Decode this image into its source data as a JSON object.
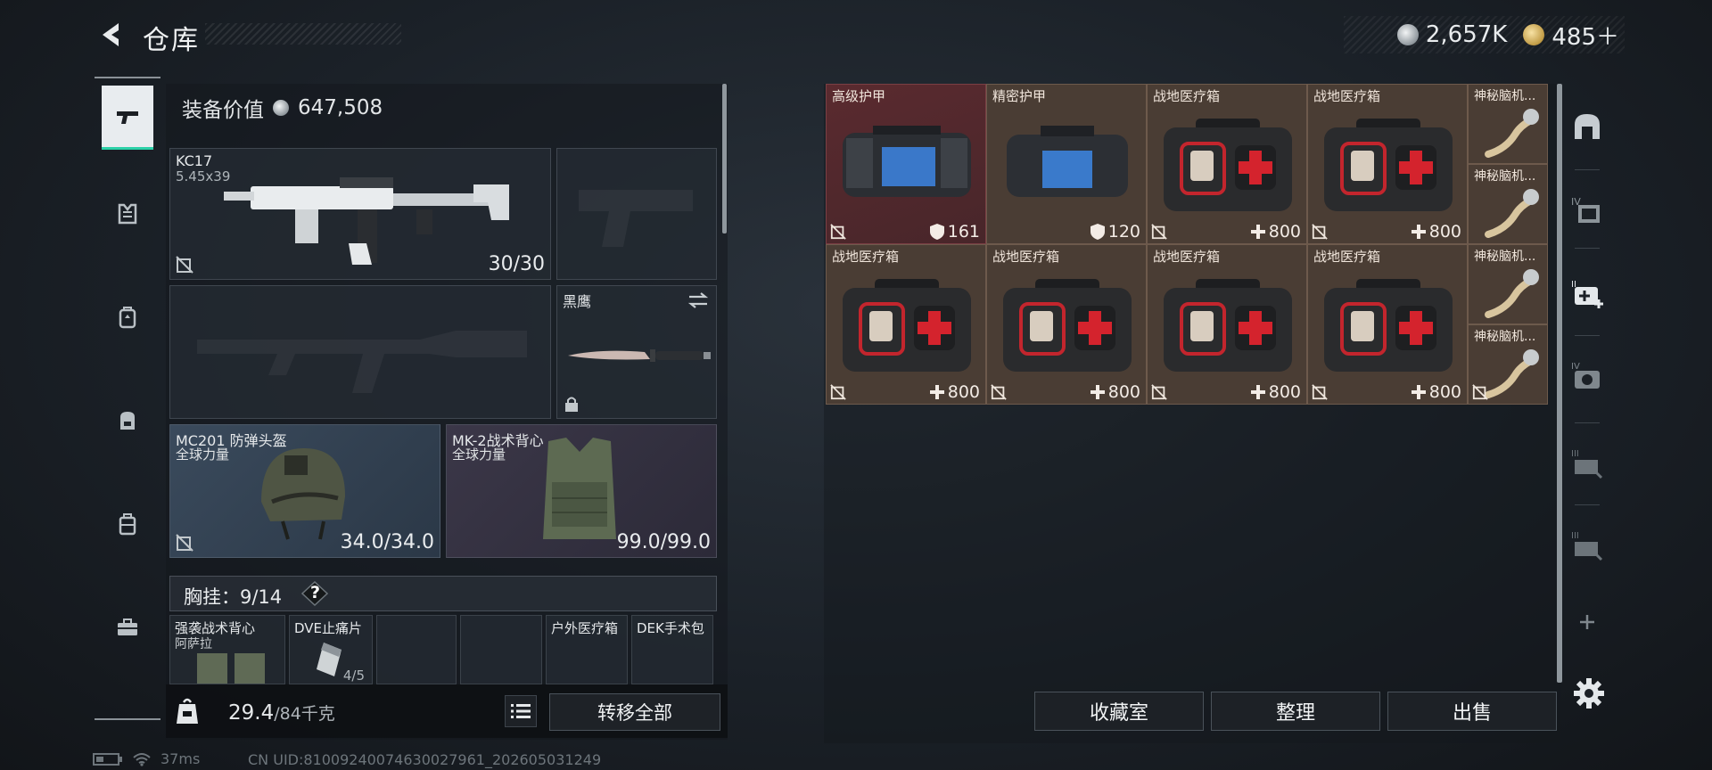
{
  "header": {
    "title": "仓库",
    "silver_amount": "2,657K",
    "gold_amount": "485＋"
  },
  "left_rail": {
    "items": [
      {
        "icon": "pistol-icon",
        "active": true
      },
      {
        "icon": "armor-icon",
        "active": false
      },
      {
        "icon": "backpack-icon",
        "active": false
      },
      {
        "icon": "bag-icon",
        "active": false
      },
      {
        "icon": "case-icon",
        "active": false
      },
      {
        "icon": "toolbox-icon",
        "active": false
      }
    ]
  },
  "equipment": {
    "value_label": "装备价值",
    "value": "647,508",
    "primary_weapon": {
      "name": "KC17",
      "caliber": "5.45x39",
      "ammo": "30/30"
    },
    "melee": {
      "name": "黑鹰"
    },
    "helmet": {
      "name": "MC201 防弹头盔",
      "brand": "全球力量",
      "durability": "34.0/34.0"
    },
    "vest": {
      "name": "MK-2战术背心",
      "brand": "全球力量",
      "durability": "99.0/99.0"
    }
  },
  "chest_rig": {
    "label": "胸挂：",
    "capacity": "9/14",
    "help": "?",
    "slots": [
      {
        "name": "强袭战术背心",
        "sub": "阿萨拉",
        "count": ""
      },
      {
        "name": "DVE止痛片",
        "sub": "",
        "count": "4/5"
      },
      {
        "name": "",
        "sub": "",
        "count": ""
      },
      {
        "name": "",
        "sub": "",
        "count": ""
      },
      {
        "name": "户外医疗箱",
        "sub": "",
        "count": ""
      },
      {
        "name": "DEK手术包",
        "sub": "",
        "count": ""
      }
    ]
  },
  "bottom_bar": {
    "weight": "29.4",
    "weight_max": "/84千克",
    "transfer_all": "转移全部"
  },
  "stash": {
    "row1": [
      {
        "name": "高级护甲",
        "value": "161",
        "kind": "armor",
        "rarity": "red"
      },
      {
        "name": "精密护甲",
        "value": "120",
        "kind": "armor",
        "rarity": "normal"
      },
      {
        "name": "战地医疗箱",
        "value": "800",
        "kind": "medkit",
        "rarity": "normal"
      },
      {
        "name": "战地医疗箱",
        "value": "800",
        "kind": "medkit",
        "rarity": "normal"
      }
    ],
    "row2": [
      {
        "name": "战地医疗箱",
        "value": "800",
        "kind": "medkit",
        "rarity": "normal"
      },
      {
        "name": "战地医疗箱",
        "value": "800",
        "kind": "medkit",
        "rarity": "normal"
      },
      {
        "name": "战地医疗箱",
        "value": "800",
        "kind": "medkit",
        "rarity": "normal"
      },
      {
        "name": "战地医疗箱",
        "value": "800",
        "kind": "medkit",
        "rarity": "normal"
      }
    ],
    "small": [
      {
        "name": "神秘脑机..."
      },
      {
        "name": "神秘脑机..."
      },
      {
        "name": "神秘脑机..."
      },
      {
        "name": "神秘脑机..."
      }
    ]
  },
  "actions": {
    "collection": "收藏室",
    "sort": "整理",
    "sell": "出售"
  },
  "status": {
    "ping": "37ms",
    "uid": "CN UID:81009240074630027961_202605031249"
  },
  "colors": {
    "accent": "#2bd1a8",
    "rarity_red": "#5a2a2f",
    "cell_brown": "#4a3d34"
  }
}
